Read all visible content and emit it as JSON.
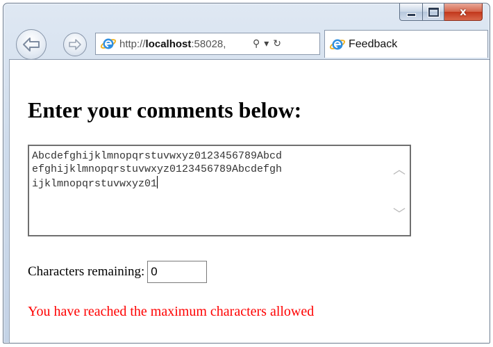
{
  "window": {
    "close_glyph": "x"
  },
  "navbar": {
    "address_host_prefix": "http://",
    "address_host": "localhost",
    "address_rest": ":58028,",
    "search_glyph": "⚲",
    "dropdown_glyph": "▾",
    "refresh_glyph": "↻",
    "tab_title": "Feedback"
  },
  "page": {
    "heading": "Enter your comments below:",
    "textarea_value": "Abcdefghijklmnopqrstuvwxyz0123456789Abcd\nefghijklmnopqrstuvwxyz0123456789Abcdefgh\nijklmnopqrstuvwxyz01",
    "remaining_label": "Characters remaining:",
    "remaining_value": "0",
    "limit_message": "You have reached the maximum characters allowed",
    "message_color": "#ff0000"
  }
}
